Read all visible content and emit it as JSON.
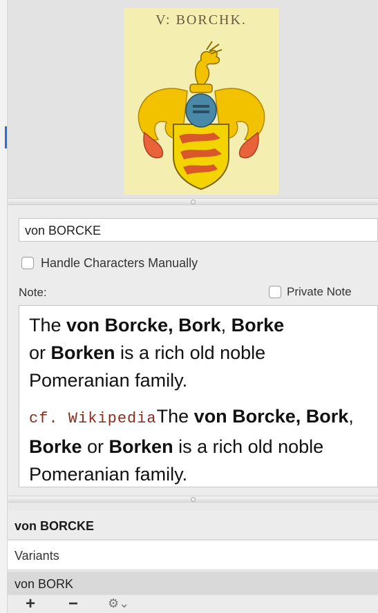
{
  "image": {
    "caption": "V: BORCHK.",
    "alt_icon": "coat-of-arms-image"
  },
  "name_field": {
    "value": "von BORCKE"
  },
  "handle_characters": {
    "label": "Handle Characters Manually",
    "checked": false
  },
  "note": {
    "label": "Note:",
    "private_label": "Private Note",
    "private_checked": false,
    "para1": {
      "t1": "The ",
      "b1": "von Borcke, Bork",
      "t2": ", ",
      "b2": "Borke",
      "t3": " or ",
      "b3": "Borken",
      "t4": " is a rich old noble Pomeranian family."
    },
    "para2": {
      "link": "cf. Wikipedia",
      "t1": "The ",
      "b1": "von Borcke, Bork",
      "t2": ", ",
      "b2": "Borke",
      "t3": " or ",
      "b3": "Borken",
      "t4": " is a rich old noble Pomeranian family."
    }
  },
  "list": {
    "header": "von BORCKE",
    "variants_placeholder": "Variants",
    "rows": [
      "von BORK"
    ]
  },
  "toolbar": {
    "add": "+",
    "remove": "−",
    "gear": "⚙⌄"
  },
  "colors": {
    "link": "#8a2b1b",
    "selected_row": "#d9d9d9",
    "accent": "#2a6fd8"
  }
}
